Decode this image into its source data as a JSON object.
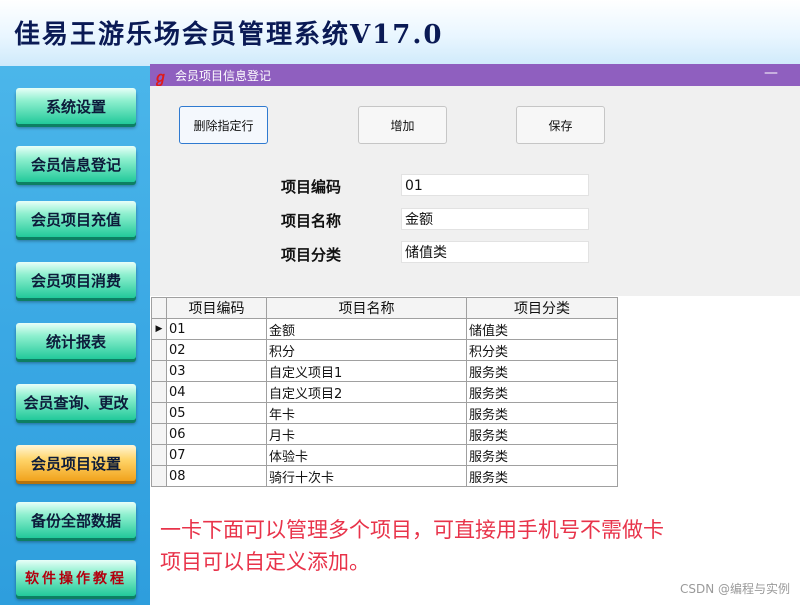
{
  "app": {
    "title": "佳易王游乐场会员管理系统V17.0"
  },
  "sidebar": {
    "items": [
      {
        "label": "系统设置"
      },
      {
        "label": "会员信息登记"
      },
      {
        "label": "会员项目充值"
      },
      {
        "label": "会员项目消费"
      },
      {
        "label": "统计报表"
      },
      {
        "label": "会员查询、更改"
      },
      {
        "label": "会员项目设置"
      },
      {
        "label": "备份全部数据"
      },
      {
        "label": "软件操作教程"
      }
    ]
  },
  "window": {
    "title": "会员项目信息登记",
    "minimize": "—",
    "buttons": {
      "delete": "删除指定行",
      "add": "增加",
      "save": "保存"
    },
    "form": {
      "code_label": "项目编码",
      "code_value": "01",
      "name_label": "项目名称",
      "name_value": "金额",
      "category_label": "项目分类",
      "category_value": "储值类"
    },
    "grid": {
      "columns": [
        "项目编码",
        "项目名称",
        "项目分类"
      ],
      "rows": [
        [
          "01",
          "金额",
          "储值类"
        ],
        [
          "02",
          "积分",
          "积分类"
        ],
        [
          "03",
          "自定义项目1",
          "服务类"
        ],
        [
          "04",
          "自定义项目2",
          "服务类"
        ],
        [
          "05",
          "年卡",
          "服务类"
        ],
        [
          "06",
          "月卡",
          "服务类"
        ],
        [
          "07",
          "体验卡",
          "服务类"
        ],
        [
          "08",
          "骑行十次卡",
          "服务类"
        ]
      ],
      "current_row_marker": "▶"
    },
    "note": {
      "line1": "一卡下面可以管理多个项目，可直接用手机号不需做卡",
      "line2": "项目可以自定义添加。"
    },
    "watermark": "CSDN @编程与实例"
  },
  "colors": {
    "titlebar": "#8f5fbf",
    "sidebar_button": "#22c99a",
    "sidebar_active": "#f1a21c",
    "note_text": "#e8334a"
  }
}
